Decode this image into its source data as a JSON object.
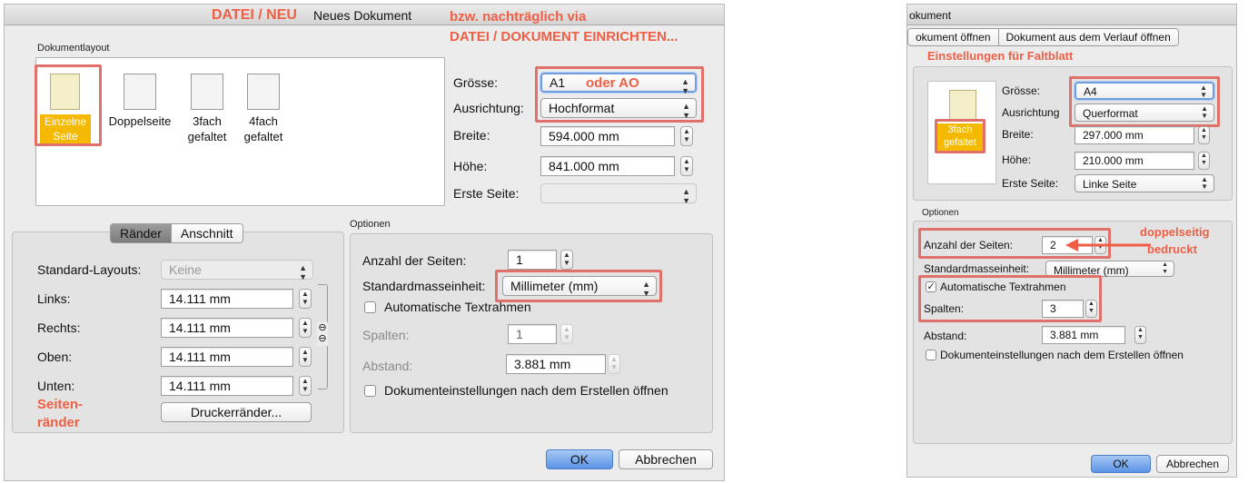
{
  "left": {
    "titlebar": {
      "annotation_red": "DATEI / NEU",
      "title": "Neues Dokument",
      "annotation_right_1": "bzw. nachträglich via",
      "annotation_right_2": "DATEI / DOKUMENT EINRICHTEN..."
    },
    "layout_section_label": "Dokumentlayout",
    "layouts": [
      {
        "line1": "Einzelne",
        "line2": "Seite",
        "selected": true
      },
      {
        "line1": "Doppelseite",
        "line2": "",
        "selected": false
      },
      {
        "line1": "3fach",
        "line2": "gefaltet",
        "selected": false
      },
      {
        "line1": "4fach",
        "line2": "gefaltet",
        "selected": false
      }
    ],
    "props": {
      "groesse_label": "Grösse:",
      "groesse_value": "A1",
      "groesse_annotation": "oder AO",
      "ausrichtung_label": "Ausrichtung:",
      "ausrichtung_value": "Hochformat",
      "breite_label": "Breite:",
      "breite_value": "594.000 mm",
      "hoehe_label": "Höhe:",
      "hoehe_value": "841.000 mm",
      "erste_label": "Erste Seite:",
      "erste_value": ""
    },
    "tabs": [
      "Ränder",
      "Anschnitt"
    ],
    "margins": {
      "standard_label": "Standard-Layouts:",
      "standard_value": "Keine",
      "links_label": "Links:",
      "links_value": "14.111 mm",
      "rechts_label": "Rechts:",
      "rechts_value": "14.111 mm",
      "oben_label": "Oben:",
      "oben_value": "14.111 mm",
      "unten_label": "Unten:",
      "unten_value": "14.111 mm",
      "annotation_1": "Seiten-",
      "annotation_2": "ränder",
      "drucker_button": "Druckerränder..."
    },
    "optionen": {
      "section_label": "Optionen",
      "anzahl_label": "Anzahl der Seiten:",
      "anzahl_value": "1",
      "einheit_label": "Standardmasseinheit:",
      "einheit_value": "Millimeter (mm)",
      "auto_text_label": "Automatische Textrahmen",
      "spalten_label": "Spalten:",
      "spalten_value": "1",
      "abstand_label": "Abstand:",
      "abstand_value": "3.881 mm",
      "dok_einst_label": "Dokumenteinstellungen nach dem Erstellen öffnen"
    },
    "buttons": {
      "ok": "OK",
      "cancel": "Abbrechen"
    }
  },
  "right": {
    "titlebar": {
      "title": "okument"
    },
    "tabs": [
      "okument öffnen",
      "Dokument aus dem Verlauf öffnen"
    ],
    "annotation_top": "Einstellungen für Faltblatt",
    "layout": {
      "line1": "3fach",
      "line2": "gefaltet"
    },
    "props": {
      "groesse_label": "Grösse:",
      "groesse_value": "A4",
      "ausrichtung_label": "Ausrichtung",
      "ausrichtung_value": "Querformat",
      "breite_label": "Breite:",
      "breite_value": "297.000 mm",
      "hoehe_label": "Höhe:",
      "hoehe_value": "210.000 mm",
      "erste_label": "Erste Seite:",
      "erste_value": "Linke Seite"
    },
    "optionen": {
      "section_label": "Optionen",
      "anzahl_label": "Anzahl der Seiten:",
      "anzahl_value": "2",
      "annotation_1": "doppelseitig",
      "annotation_2": "bedruckt",
      "einheit_label": "Standardmasseinheit:",
      "einheit_value": "Millimeter (mm)",
      "auto_text_label": "Automatische Textrahmen",
      "spalten_label": "Spalten:",
      "spalten_value": "3",
      "abstand_label": "Abstand:",
      "abstand_value": "3.881 mm",
      "dok_einst_label": "Dokumenteinstellungen nach dem Erstellen öffnen"
    },
    "buttons": {
      "ok": "OK",
      "cancel": "Abbrechen"
    }
  },
  "colors": {
    "annotation": "#ee5f45",
    "highlight_box": "#e0706a",
    "selected_layout": "#f5b900",
    "default_button": "#5b93e6"
  },
  "icons": {
    "stepper": "up-down-arrows",
    "select": "up-down-chevrons",
    "link": "chain-link-icon"
  }
}
